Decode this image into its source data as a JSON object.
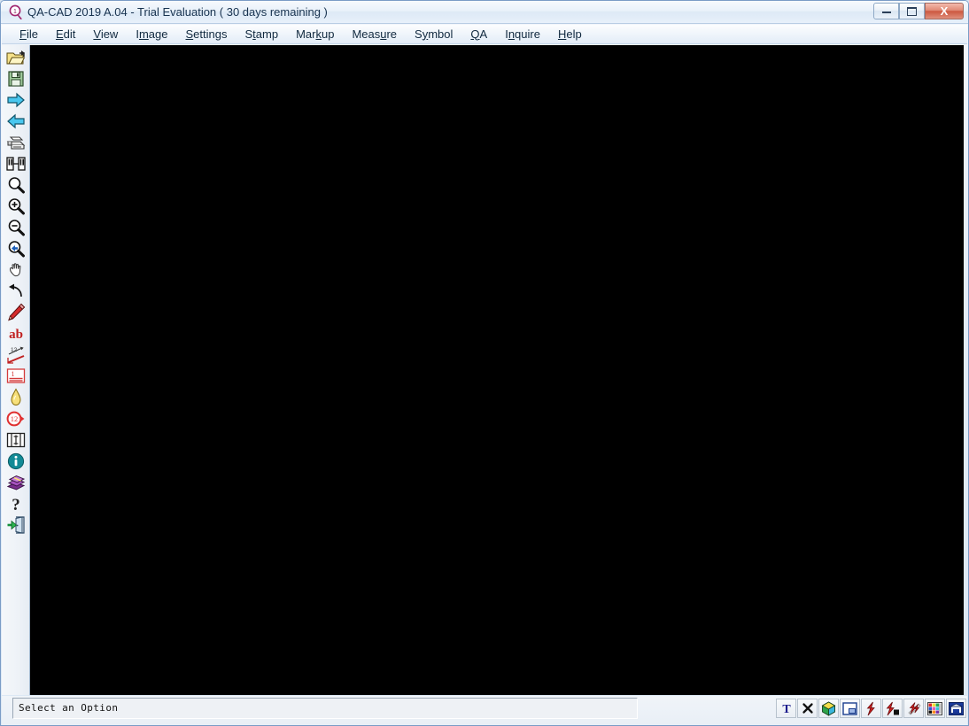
{
  "window": {
    "title": "QA-CAD 2019 A.04 - Trial Evaluation ( 30 days remaining )",
    "app_icon": "qa-cad-logo-icon",
    "controls": {
      "minimize": "minimize-button",
      "maximize": "maximize-button",
      "close_label": "X"
    }
  },
  "menubar": {
    "items": [
      {
        "label": "File",
        "mnemonic": "F"
      },
      {
        "label": "Edit",
        "mnemonic": "E"
      },
      {
        "label": "View",
        "mnemonic": "V"
      },
      {
        "label": "Image",
        "mnemonic": "m"
      },
      {
        "label": "Settings",
        "mnemonic": "S"
      },
      {
        "label": "Stamp",
        "mnemonic": "t"
      },
      {
        "label": "Markup",
        "mnemonic": "k"
      },
      {
        "label": "Measure",
        "mnemonic": "u"
      },
      {
        "label": "Symbol",
        "mnemonic": "y"
      },
      {
        "label": "QA",
        "mnemonic": "Q"
      },
      {
        "label": "Inquire",
        "mnemonic": "n"
      },
      {
        "label": "Help",
        "mnemonic": "H"
      }
    ]
  },
  "toolbar": {
    "items": [
      {
        "name": "open-file-icon",
        "tooltip": "Open"
      },
      {
        "name": "save-file-icon",
        "tooltip": "Save"
      },
      {
        "name": "next-page-icon",
        "tooltip": "Next Page"
      },
      {
        "name": "previous-page-icon",
        "tooltip": "Previous Page"
      },
      {
        "name": "print-icon",
        "tooltip": "Print"
      },
      {
        "name": "compare-images-icon",
        "tooltip": "Compare"
      },
      {
        "name": "zoom-icon",
        "tooltip": "Zoom"
      },
      {
        "name": "zoom-in-icon",
        "tooltip": "Zoom In"
      },
      {
        "name": "zoom-out-icon",
        "tooltip": "Zoom Out"
      },
      {
        "name": "zoom-window-icon",
        "tooltip": "Zoom Window"
      },
      {
        "name": "pan-hand-icon",
        "tooltip": "Pan"
      },
      {
        "name": "undo-icon",
        "tooltip": "Undo"
      },
      {
        "name": "pencil-markup-icon",
        "tooltip": "Markup Pencil"
      },
      {
        "name": "text-ab-icon",
        "tooltip": "Text"
      },
      {
        "name": "dimension-icon",
        "tooltip": "Dimension"
      },
      {
        "name": "balloon-line-icon",
        "tooltip": "Balloon Line"
      },
      {
        "name": "bulb-icon",
        "tooltip": "Hint"
      },
      {
        "name": "balloon-number-icon",
        "tooltip": "Balloon Number"
      },
      {
        "name": "tolerance-icon",
        "tooltip": "Tolerance"
      },
      {
        "name": "info-icon",
        "tooltip": "Information"
      },
      {
        "name": "book-icon",
        "tooltip": "Manual"
      },
      {
        "name": "help-question-icon",
        "tooltip": "Help"
      },
      {
        "name": "exit-door-icon",
        "tooltip": "Exit"
      }
    ]
  },
  "canvas": {
    "background_color": "#000000"
  },
  "statusbar": {
    "message": "Select an Option",
    "icons": [
      {
        "name": "text-tool-icon",
        "label": "T"
      },
      {
        "name": "delete-x-icon",
        "label": "x"
      },
      {
        "name": "cube-3d-icon",
        "label": ""
      },
      {
        "name": "window-layout-icon",
        "label": ""
      },
      {
        "name": "lightning-red-icon",
        "label": ""
      },
      {
        "name": "lightning-fill-icon",
        "label": ""
      },
      {
        "name": "lightning-multi-icon",
        "label": ""
      },
      {
        "name": "color-palette-icon",
        "label": ""
      },
      {
        "name": "archive-box-icon",
        "label": ""
      }
    ]
  },
  "colors": {
    "titlebar_top": "#f6f9fd",
    "titlebar_bottom": "#e7f0fa",
    "close_button": "#cc5840",
    "canvas": "#000000",
    "accent_red": "#cc2222",
    "accent_blue": "#0b4ea2",
    "toolbar_bg": "#eef2f7"
  }
}
